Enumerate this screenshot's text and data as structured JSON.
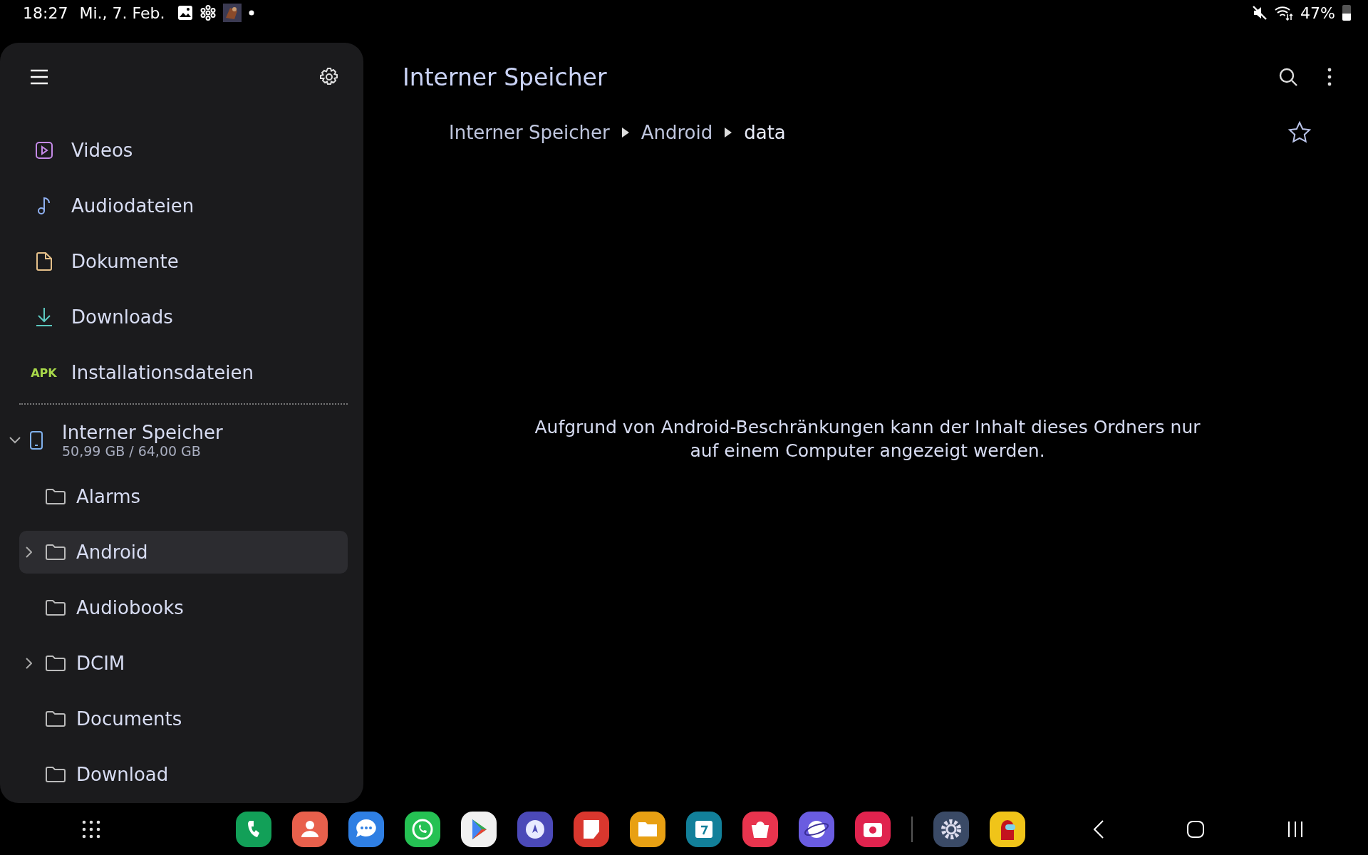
{
  "status_bar": {
    "time": "18:27",
    "date": "Mi., 7. Feb.",
    "battery_text": "47%",
    "battery": {
      "level": 0.47
    }
  },
  "sidebar": {
    "categories": [
      {
        "label": "Videos",
        "kind": "video"
      },
      {
        "label": "Audiodateien",
        "kind": "audio"
      },
      {
        "label": "Dokumente",
        "kind": "document"
      },
      {
        "label": "Downloads",
        "kind": "download"
      },
      {
        "label": "Installationsdateien",
        "kind": "apk",
        "badge": "APK"
      }
    ],
    "storage": {
      "name": "Interner Speicher",
      "usage": "50,99 GB / 64,00 GB",
      "expanded": true
    },
    "folders": [
      {
        "name": "Alarms",
        "expandable": false,
        "selected": false
      },
      {
        "name": "Android",
        "expandable": true,
        "selected": true
      },
      {
        "name": "Audiobooks",
        "expandable": false,
        "selected": false
      },
      {
        "name": "DCIM",
        "expandable": true,
        "selected": false
      },
      {
        "name": "Documents",
        "expandable": false,
        "selected": false
      },
      {
        "name": "Download",
        "expandable": false,
        "selected": false
      }
    ]
  },
  "main": {
    "title": "Interner Speicher",
    "breadcrumb": [
      "Interner Speicher",
      "Android",
      "data"
    ],
    "message": "Aufgrund von Android-Beschränkungen kann der Inhalt dieses Ordners nur auf einem Computer angezeigt werden."
  },
  "dock": [
    {
      "kind": "phone",
      "color": "#12a058"
    },
    {
      "kind": "contacts",
      "color": "#e8604c"
    },
    {
      "kind": "messages",
      "color": "#2f7fe3"
    },
    {
      "kind": "chat",
      "color": "#25c153"
    },
    {
      "kind": "store",
      "color": "#f1f1f1"
    },
    {
      "kind": "compass",
      "color": "#4b49b8"
    },
    {
      "kind": "notes",
      "color": "#d9372e"
    },
    {
      "kind": "files",
      "color": "#e8a013"
    },
    {
      "kind": "calendar",
      "color": "#12809a"
    },
    {
      "kind": "bag",
      "color": "#e8344e"
    },
    {
      "kind": "browser",
      "color": "#6a5ce0"
    },
    {
      "kind": "camera",
      "color": "#e0234e"
    },
    {
      "kind": "divider",
      "color": "#555555"
    },
    {
      "kind": "settings",
      "color": "#3a4a66"
    },
    {
      "kind": "game",
      "color": "#f0c419"
    }
  ]
}
